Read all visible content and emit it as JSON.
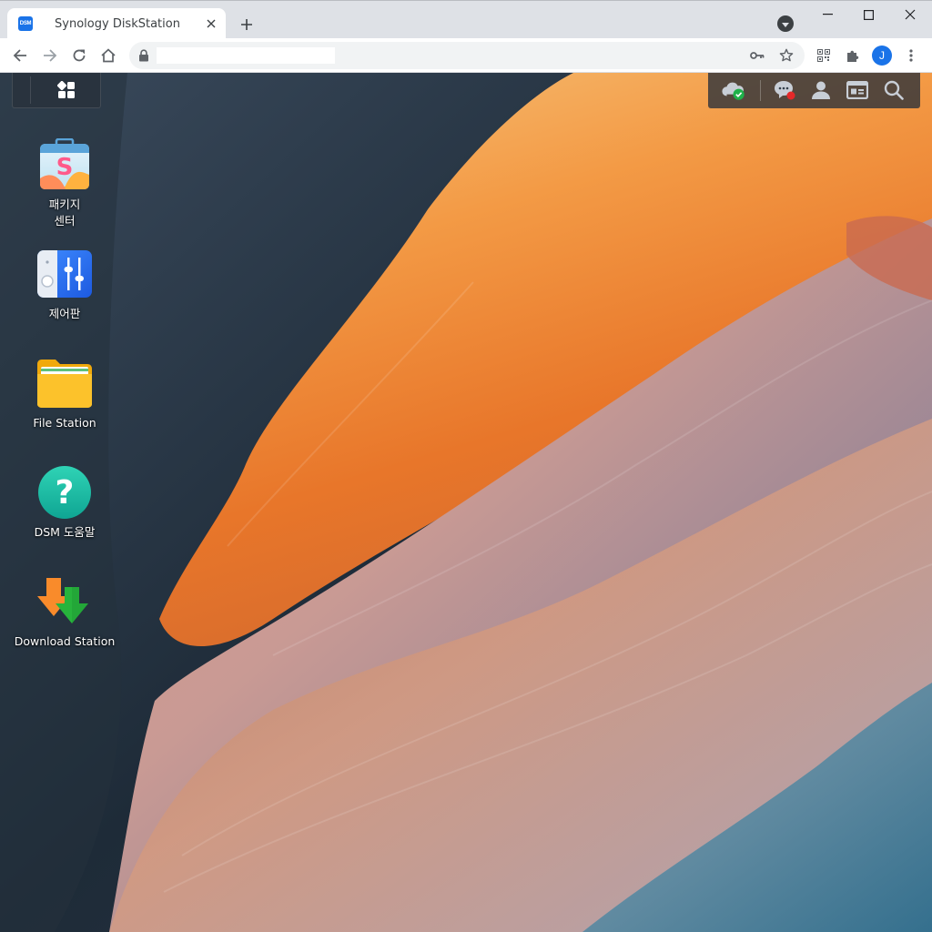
{
  "browser": {
    "tab": {
      "favicon_text": "DSM",
      "title": "Synology DiskStation"
    },
    "url": "",
    "icons": [
      "back-icon",
      "forward-icon",
      "reload-icon",
      "home-icon",
      "lock-icon",
      "key-icon",
      "star-icon",
      "qr-icon",
      "puzzle-icon",
      "kebab-icon"
    ],
    "profile_initial": "J"
  },
  "desktop": {
    "icons": [
      {
        "label": "패키지\n센터",
        "icon": "package-center-icon"
      },
      {
        "label": "제어판",
        "icon": "control-panel-icon"
      },
      {
        "label": "File Station",
        "icon": "folder-icon"
      },
      {
        "label": "DSM 도움말",
        "icon": "help-icon"
      },
      {
        "label": "Download Station",
        "icon": "download-icon"
      }
    ],
    "tray": [
      "cloud-check-icon",
      "chat-icon",
      "user-icon",
      "widget-icon",
      "search-icon"
    ],
    "colors": {
      "accent": "#1a73e8",
      "status_ok": "#1fb14a",
      "notification": "#e52929"
    }
  }
}
